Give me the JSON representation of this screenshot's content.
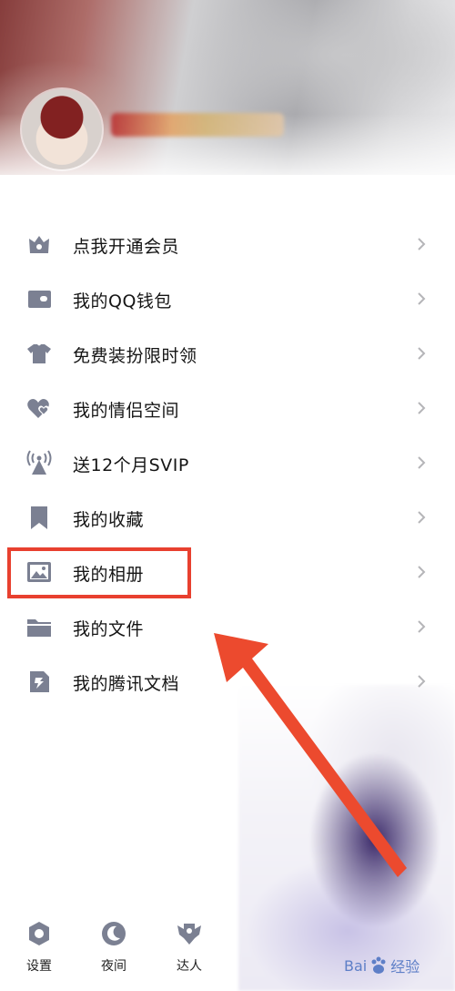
{
  "menu": {
    "items": [
      {
        "label": "点我开通会员",
        "icon": "crown-icon"
      },
      {
        "label": "我的QQ钱包",
        "icon": "wallet-icon"
      },
      {
        "label": "免费装扮限时领",
        "icon": "shirt-icon"
      },
      {
        "label": "我的情侣空间",
        "icon": "hearts-icon"
      },
      {
        "label": "送12个月SVIP",
        "icon": "broadcast-icon"
      },
      {
        "label": "我的收藏",
        "icon": "bookmark-icon"
      },
      {
        "label": "我的相册",
        "icon": "photo-icon"
      },
      {
        "label": "我的文件",
        "icon": "folder-icon"
      },
      {
        "label": "我的腾讯文档",
        "icon": "docs-icon"
      }
    ]
  },
  "bottom_bar": {
    "settings": "设置",
    "night": "夜间",
    "expert": "达人"
  },
  "watermark": {
    "brand_a": "Bai",
    "brand_b": "经验"
  },
  "colors": {
    "icon": "#7b8092",
    "highlight": "#e8402f",
    "arrow": "#ec4a2e"
  }
}
